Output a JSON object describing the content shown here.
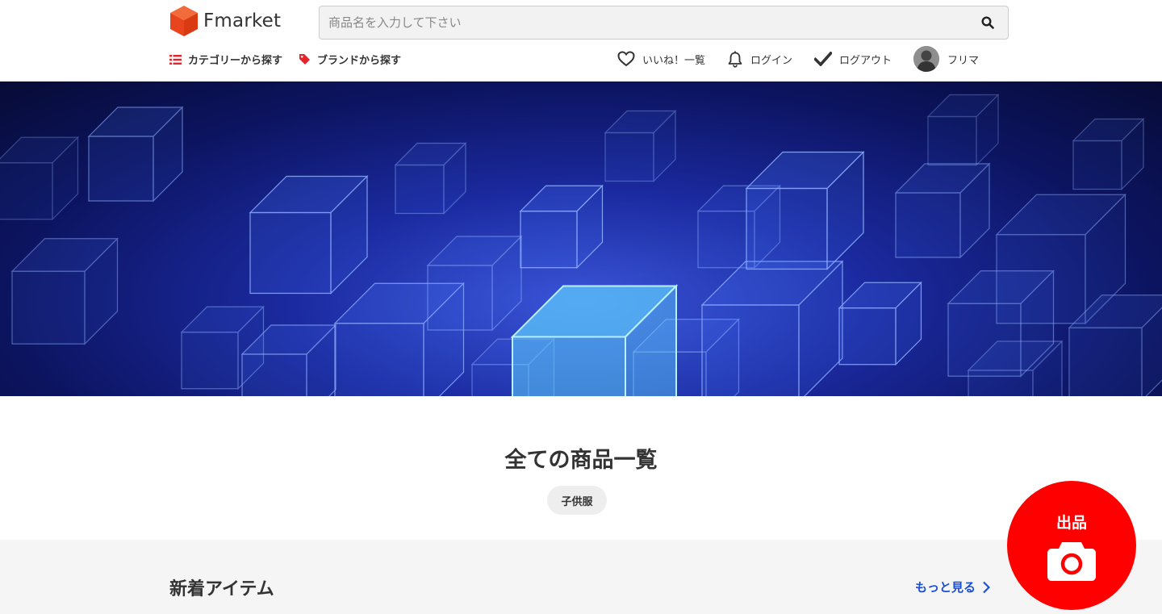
{
  "header": {
    "logo_text": "Fmarket",
    "search_placeholder": "商品名を入力して下さい",
    "nav_left": [
      {
        "label": "カテゴリーから探す",
        "icon": "list-icon"
      },
      {
        "label": "ブランドから探す",
        "icon": "tag-icon"
      }
    ],
    "nav_right": [
      {
        "label": "いいね！一覧",
        "icon": "heart-icon"
      },
      {
        "label": "ログイン",
        "icon": "bell-icon"
      },
      {
        "label": "ログアウト",
        "icon": "check-icon"
      },
      {
        "label": "フリマ",
        "icon": "avatar"
      }
    ]
  },
  "hero": {
    "theme": "blue glowing cubes banner"
  },
  "main": {
    "title": "全ての商品一覧",
    "tag_chip": "子供服"
  },
  "new_items": {
    "title": "新着アイテム",
    "more_link": "もっと見る"
  },
  "sell_button": {
    "label": "出品",
    "icon": "camera-icon"
  },
  "colors": {
    "brand": "#ff0000",
    "link": "#1a4fd6",
    "logo": "#e8451e"
  }
}
